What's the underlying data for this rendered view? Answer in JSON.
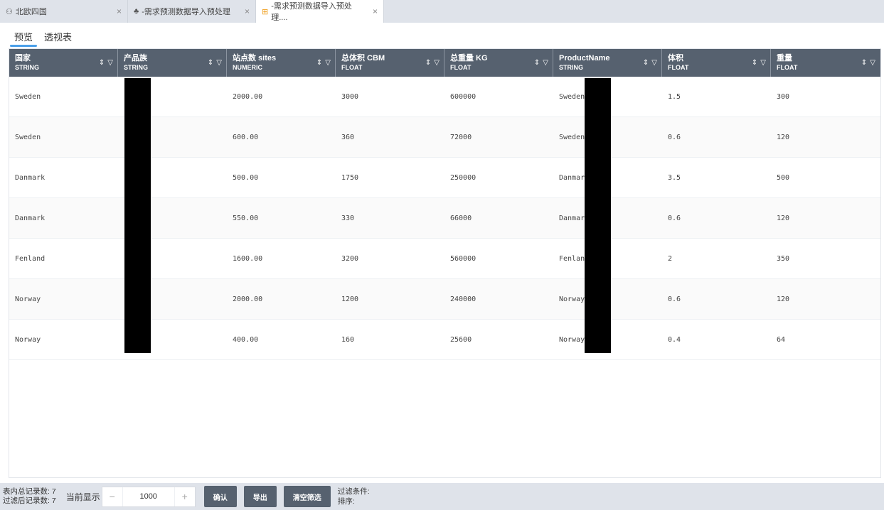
{
  "tabs": [
    {
      "icon": "⚇",
      "label": "北欧四国",
      "close": "×"
    },
    {
      "icon": "♣",
      "label": "-需求预测数据导入预处理",
      "close": "×"
    },
    {
      "icon": "⊞",
      "label": "-需求预测数据导入预处理....",
      "close": "×"
    }
  ],
  "view_tabs": [
    {
      "label": "预览",
      "active": true
    },
    {
      "label": "透视表",
      "active": false
    }
  ],
  "table": {
    "sort_icon": "⇕",
    "filter_icon": "▽",
    "columns": [
      {
        "name": "国家",
        "type": "STRING"
      },
      {
        "name": "产品族",
        "type": "STRING"
      },
      {
        "name": "站点数 sites",
        "type": "NUMERIC"
      },
      {
        "name": "总体积 CBM",
        "type": "FLOAT"
      },
      {
        "name": "总重量 KG",
        "type": "FLOAT"
      },
      {
        "name": "ProductName",
        "type": "STRING"
      },
      {
        "name": "体积",
        "type": "FLOAT"
      },
      {
        "name": "重量",
        "type": "FLOAT"
      }
    ],
    "rows": [
      [
        "Sweden",
        "",
        "2000.00",
        "3000",
        "600000",
        "Sweden_",
        "1.5",
        "300"
      ],
      [
        "Sweden",
        "",
        "600.00",
        "360",
        "72000",
        "Sweden_",
        "0.6",
        "120"
      ],
      [
        "Danmark",
        "",
        "500.00",
        "1750",
        "250000",
        "Danmark",
        "3.5",
        "500"
      ],
      [
        "Danmark",
        "",
        "550.00",
        "330",
        "66000",
        "Danmark",
        "0.6",
        "120"
      ],
      [
        "Fenland",
        "",
        "1600.00",
        "3200",
        "560000",
        "Fenland",
        "2",
        "350"
      ],
      [
        "Norway",
        "",
        "2000.00",
        "1200",
        "240000",
        "Norway_",
        "0.6",
        "120"
      ],
      [
        "Norway",
        "",
        "400.00",
        "160",
        "25600",
        "Norway_",
        "0.4",
        "64"
      ]
    ]
  },
  "footer": {
    "total_records": "表内总记录数: 7",
    "filtered_records": "过滤后记录数: 7",
    "current_display_label": "当前显示",
    "minus": "−",
    "plus": "+",
    "page_size": "1000",
    "confirm_label": "确认",
    "export_label": "导出",
    "clear_filter_label": "清空筛选",
    "filter_conditions": "过滤条件:",
    "sort_label": "排序:"
  }
}
